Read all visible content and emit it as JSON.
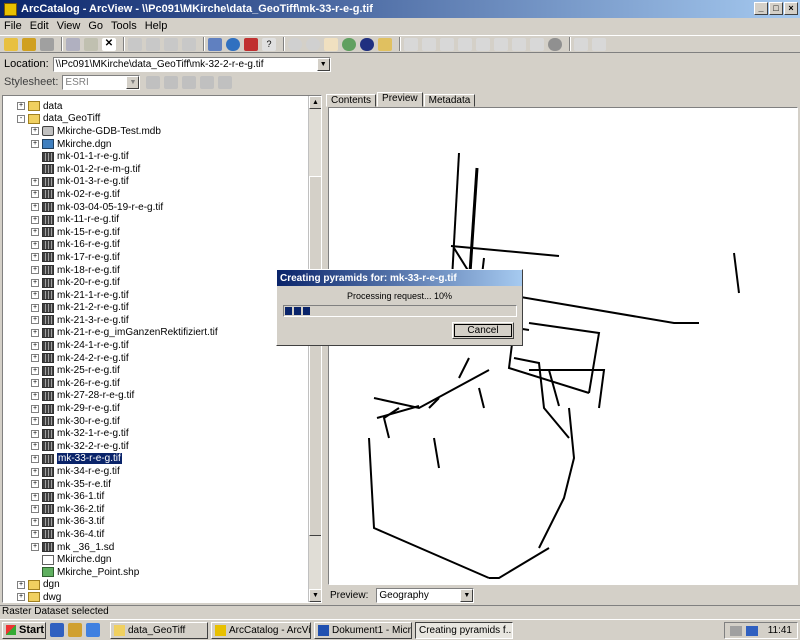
{
  "window": {
    "title": "ArcCatalog - ArcView - \\\\Pc091\\MKirche\\data_GeoTiff\\mk-33-r-e-g.tif"
  },
  "menu": [
    "File",
    "Edit",
    "View",
    "Go",
    "Tools",
    "Help"
  ],
  "location": {
    "label": "Location:",
    "value": "\\\\Pc091\\MKirche\\data_GeoTiff\\mk-32-2-r-e-g.tif"
  },
  "stylesheet": {
    "label": "Stylesheet:",
    "value": "ESRI"
  },
  "tree": [
    {
      "label": "data",
      "icon": "folder",
      "exp": "+",
      "indent": 0
    },
    {
      "label": "data_GeoTiff",
      "icon": "folder",
      "exp": "-",
      "indent": 0
    },
    {
      "label": "Mkirche-GDB-Test.mdb",
      "icon": "db",
      "exp": "+",
      "indent": 1
    },
    {
      "label": "Mkirche.dgn",
      "icon": "cad",
      "exp": "+",
      "indent": 1
    },
    {
      "label": "mk-01-1-r-e-g.tif",
      "icon": "raster",
      "exp": "",
      "indent": 1
    },
    {
      "label": "mk-01-2-r-e-m-g.tif",
      "icon": "raster",
      "exp": "",
      "indent": 1
    },
    {
      "label": "mk-01-3-r-e-g.tif",
      "icon": "raster",
      "exp": "+",
      "indent": 1
    },
    {
      "label": "mk-02-r-e-g.tif",
      "icon": "raster",
      "exp": "+",
      "indent": 1
    },
    {
      "label": "mk-03-04-05-19-r-e-g.tif",
      "icon": "raster",
      "exp": "+",
      "indent": 1
    },
    {
      "label": "mk-11-r-e-g.tif",
      "icon": "raster",
      "exp": "+",
      "indent": 1
    },
    {
      "label": "mk-15-r-e-g.tif",
      "icon": "raster",
      "exp": "+",
      "indent": 1
    },
    {
      "label": "mk-16-r-e-g.tif",
      "icon": "raster",
      "exp": "+",
      "indent": 1
    },
    {
      "label": "mk-17-r-e-g.tif",
      "icon": "raster",
      "exp": "+",
      "indent": 1
    },
    {
      "label": "mk-18-r-e-g.tif",
      "icon": "raster",
      "exp": "+",
      "indent": 1
    },
    {
      "label": "mk-20-r-e-g.tif",
      "icon": "raster",
      "exp": "+",
      "indent": 1
    },
    {
      "label": "mk-21-1-r-e-g.tif",
      "icon": "raster",
      "exp": "+",
      "indent": 1
    },
    {
      "label": "mk-21-2-r-e-g.tif",
      "icon": "raster",
      "exp": "+",
      "indent": 1
    },
    {
      "label": "mk-21-3-r-e-g.tif",
      "icon": "raster",
      "exp": "+",
      "indent": 1
    },
    {
      "label": "mk-21-r-e-g_imGanzenRektifiziert.tif",
      "icon": "raster",
      "exp": "+",
      "indent": 1
    },
    {
      "label": "mk-24-1-r-e-g.tif",
      "icon": "raster",
      "exp": "+",
      "indent": 1
    },
    {
      "label": "mk-24-2-r-e-g.tif",
      "icon": "raster",
      "exp": "+",
      "indent": 1
    },
    {
      "label": "mk-25-r-e-g.tif",
      "icon": "raster",
      "exp": "+",
      "indent": 1
    },
    {
      "label": "mk-26-r-e-g.tif",
      "icon": "raster",
      "exp": "+",
      "indent": 1
    },
    {
      "label": "mk-27-28-r-e-g.tif",
      "icon": "raster",
      "exp": "+",
      "indent": 1
    },
    {
      "label": "mk-29-r-e-g.tif",
      "icon": "raster",
      "exp": "+",
      "indent": 1
    },
    {
      "label": "mk-30-r-e-g.tif",
      "icon": "raster",
      "exp": "+",
      "indent": 1
    },
    {
      "label": "mk-32-1-r-e-g.tif",
      "icon": "raster",
      "exp": "+",
      "indent": 1
    },
    {
      "label": "mk-32-2-r-e-g.tif",
      "icon": "raster",
      "exp": "+",
      "indent": 1
    },
    {
      "label": "mk-33-r-e-g.tif",
      "icon": "raster",
      "exp": "+",
      "indent": 1,
      "selected": true
    },
    {
      "label": "mk-34-r-e-g.tif",
      "icon": "raster",
      "exp": "+",
      "indent": 1
    },
    {
      "label": "mk-35-r-e.tif",
      "icon": "raster",
      "exp": "+",
      "indent": 1
    },
    {
      "label": "mk-36-1.tif",
      "icon": "raster",
      "exp": "+",
      "indent": 1
    },
    {
      "label": "mk-36-2.tif",
      "icon": "raster",
      "exp": "+",
      "indent": 1
    },
    {
      "label": "mk-36-3.tif",
      "icon": "raster",
      "exp": "+",
      "indent": 1
    },
    {
      "label": "mk-36-4.tif",
      "icon": "raster",
      "exp": "+",
      "indent": 1
    },
    {
      "label": "mk _36_1.sd",
      "icon": "raster",
      "exp": "+",
      "indent": 1
    },
    {
      "label": "Mkirche.dgn",
      "icon": "doc",
      "exp": "",
      "indent": 1
    },
    {
      "label": "Mkirche_Point.shp",
      "icon": "shp",
      "exp": "",
      "indent": 1
    },
    {
      "label": "dgn",
      "icon": "folder",
      "exp": "+",
      "indent": 0
    },
    {
      "label": "dwg",
      "icon": "folder",
      "exp": "+",
      "indent": 0
    }
  ],
  "tabs": [
    "Contents",
    "Preview",
    "Metadata"
  ],
  "preview": {
    "label": "Preview:",
    "value": "Geography"
  },
  "dialog": {
    "title": "Creating pyramids for: mk-33-r-e-g.tif",
    "message": "Processing request... 10%",
    "progress_fraction": 0.1,
    "cancel_label": "Cancel"
  },
  "status": "Raster Dataset selected",
  "taskbar": {
    "start": "Start",
    "tasks": [
      {
        "label": "data_GeoTiff",
        "active": false
      },
      {
        "label": "ArcCatalog - ArcVie...",
        "active": false
      },
      {
        "label": "Dokument1 - Micro...",
        "active": false
      },
      {
        "label": "Creating pyramids f...",
        "active": true
      }
    ],
    "clock": "11:41"
  },
  "colors": {
    "title_bar": "#0a246a",
    "selection": "#0a246a",
    "face": "#d4d0c8"
  }
}
